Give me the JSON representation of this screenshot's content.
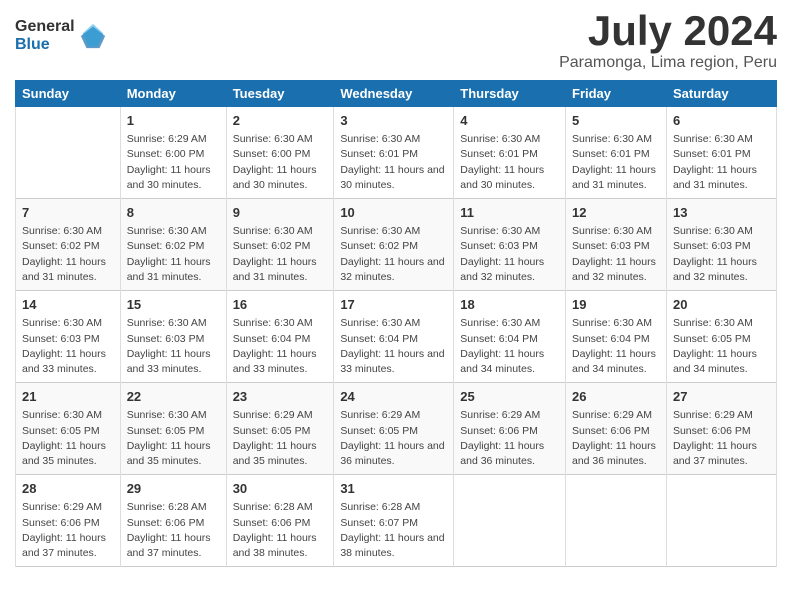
{
  "logo": {
    "general": "General",
    "blue": "Blue"
  },
  "title": "July 2024",
  "location": "Paramonga, Lima region, Peru",
  "days_of_week": [
    "Sunday",
    "Monday",
    "Tuesday",
    "Wednesday",
    "Thursday",
    "Friday",
    "Saturday"
  ],
  "weeks": [
    [
      {
        "num": "",
        "sunrise": "",
        "sunset": "",
        "daylight": ""
      },
      {
        "num": "1",
        "sunrise": "Sunrise: 6:29 AM",
        "sunset": "Sunset: 6:00 PM",
        "daylight": "Daylight: 11 hours and 30 minutes."
      },
      {
        "num": "2",
        "sunrise": "Sunrise: 6:30 AM",
        "sunset": "Sunset: 6:00 PM",
        "daylight": "Daylight: 11 hours and 30 minutes."
      },
      {
        "num": "3",
        "sunrise": "Sunrise: 6:30 AM",
        "sunset": "Sunset: 6:01 PM",
        "daylight": "Daylight: 11 hours and 30 minutes."
      },
      {
        "num": "4",
        "sunrise": "Sunrise: 6:30 AM",
        "sunset": "Sunset: 6:01 PM",
        "daylight": "Daylight: 11 hours and 30 minutes."
      },
      {
        "num": "5",
        "sunrise": "Sunrise: 6:30 AM",
        "sunset": "Sunset: 6:01 PM",
        "daylight": "Daylight: 11 hours and 31 minutes."
      },
      {
        "num": "6",
        "sunrise": "Sunrise: 6:30 AM",
        "sunset": "Sunset: 6:01 PM",
        "daylight": "Daylight: 11 hours and 31 minutes."
      }
    ],
    [
      {
        "num": "7",
        "sunrise": "Sunrise: 6:30 AM",
        "sunset": "Sunset: 6:02 PM",
        "daylight": "Daylight: 11 hours and 31 minutes."
      },
      {
        "num": "8",
        "sunrise": "Sunrise: 6:30 AM",
        "sunset": "Sunset: 6:02 PM",
        "daylight": "Daylight: 11 hours and 31 minutes."
      },
      {
        "num": "9",
        "sunrise": "Sunrise: 6:30 AM",
        "sunset": "Sunset: 6:02 PM",
        "daylight": "Daylight: 11 hours and 31 minutes."
      },
      {
        "num": "10",
        "sunrise": "Sunrise: 6:30 AM",
        "sunset": "Sunset: 6:02 PM",
        "daylight": "Daylight: 11 hours and 32 minutes."
      },
      {
        "num": "11",
        "sunrise": "Sunrise: 6:30 AM",
        "sunset": "Sunset: 6:03 PM",
        "daylight": "Daylight: 11 hours and 32 minutes."
      },
      {
        "num": "12",
        "sunrise": "Sunrise: 6:30 AM",
        "sunset": "Sunset: 6:03 PM",
        "daylight": "Daylight: 11 hours and 32 minutes."
      },
      {
        "num": "13",
        "sunrise": "Sunrise: 6:30 AM",
        "sunset": "Sunset: 6:03 PM",
        "daylight": "Daylight: 11 hours and 32 minutes."
      }
    ],
    [
      {
        "num": "14",
        "sunrise": "Sunrise: 6:30 AM",
        "sunset": "Sunset: 6:03 PM",
        "daylight": "Daylight: 11 hours and 33 minutes."
      },
      {
        "num": "15",
        "sunrise": "Sunrise: 6:30 AM",
        "sunset": "Sunset: 6:03 PM",
        "daylight": "Daylight: 11 hours and 33 minutes."
      },
      {
        "num": "16",
        "sunrise": "Sunrise: 6:30 AM",
        "sunset": "Sunset: 6:04 PM",
        "daylight": "Daylight: 11 hours and 33 minutes."
      },
      {
        "num": "17",
        "sunrise": "Sunrise: 6:30 AM",
        "sunset": "Sunset: 6:04 PM",
        "daylight": "Daylight: 11 hours and 33 minutes."
      },
      {
        "num": "18",
        "sunrise": "Sunrise: 6:30 AM",
        "sunset": "Sunset: 6:04 PM",
        "daylight": "Daylight: 11 hours and 34 minutes."
      },
      {
        "num": "19",
        "sunrise": "Sunrise: 6:30 AM",
        "sunset": "Sunset: 6:04 PM",
        "daylight": "Daylight: 11 hours and 34 minutes."
      },
      {
        "num": "20",
        "sunrise": "Sunrise: 6:30 AM",
        "sunset": "Sunset: 6:05 PM",
        "daylight": "Daylight: 11 hours and 34 minutes."
      }
    ],
    [
      {
        "num": "21",
        "sunrise": "Sunrise: 6:30 AM",
        "sunset": "Sunset: 6:05 PM",
        "daylight": "Daylight: 11 hours and 35 minutes."
      },
      {
        "num": "22",
        "sunrise": "Sunrise: 6:30 AM",
        "sunset": "Sunset: 6:05 PM",
        "daylight": "Daylight: 11 hours and 35 minutes."
      },
      {
        "num": "23",
        "sunrise": "Sunrise: 6:29 AM",
        "sunset": "Sunset: 6:05 PM",
        "daylight": "Daylight: 11 hours and 35 minutes."
      },
      {
        "num": "24",
        "sunrise": "Sunrise: 6:29 AM",
        "sunset": "Sunset: 6:05 PM",
        "daylight": "Daylight: 11 hours and 36 minutes."
      },
      {
        "num": "25",
        "sunrise": "Sunrise: 6:29 AM",
        "sunset": "Sunset: 6:06 PM",
        "daylight": "Daylight: 11 hours and 36 minutes."
      },
      {
        "num": "26",
        "sunrise": "Sunrise: 6:29 AM",
        "sunset": "Sunset: 6:06 PM",
        "daylight": "Daylight: 11 hours and 36 minutes."
      },
      {
        "num": "27",
        "sunrise": "Sunrise: 6:29 AM",
        "sunset": "Sunset: 6:06 PM",
        "daylight": "Daylight: 11 hours and 37 minutes."
      }
    ],
    [
      {
        "num": "28",
        "sunrise": "Sunrise: 6:29 AM",
        "sunset": "Sunset: 6:06 PM",
        "daylight": "Daylight: 11 hours and 37 minutes."
      },
      {
        "num": "29",
        "sunrise": "Sunrise: 6:28 AM",
        "sunset": "Sunset: 6:06 PM",
        "daylight": "Daylight: 11 hours and 37 minutes."
      },
      {
        "num": "30",
        "sunrise": "Sunrise: 6:28 AM",
        "sunset": "Sunset: 6:06 PM",
        "daylight": "Daylight: 11 hours and 38 minutes."
      },
      {
        "num": "31",
        "sunrise": "Sunrise: 6:28 AM",
        "sunset": "Sunset: 6:07 PM",
        "daylight": "Daylight: 11 hours and 38 minutes."
      },
      {
        "num": "",
        "sunrise": "",
        "sunset": "",
        "daylight": ""
      },
      {
        "num": "",
        "sunrise": "",
        "sunset": "",
        "daylight": ""
      },
      {
        "num": "",
        "sunrise": "",
        "sunset": "",
        "daylight": ""
      }
    ]
  ]
}
